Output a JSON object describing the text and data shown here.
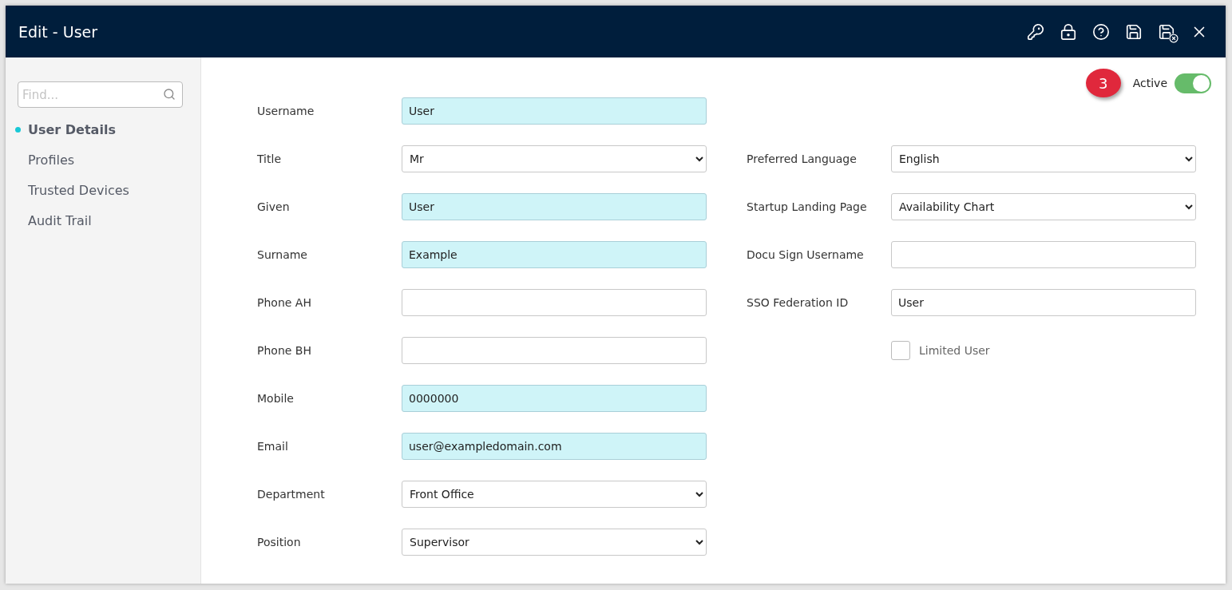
{
  "window": {
    "title": "Edit - User"
  },
  "sidebar": {
    "search": {
      "placeholder": "Find..."
    },
    "items": [
      {
        "label": "User Details",
        "selected": true
      },
      {
        "label": "Profiles",
        "selected": false
      },
      {
        "label": "Trusted Devices",
        "selected": false
      },
      {
        "label": "Audit Trail",
        "selected": false
      }
    ]
  },
  "status": {
    "label": "Active",
    "on": true,
    "callout": "3"
  },
  "left_fields": [
    {
      "label": "Username",
      "kind": "text",
      "value": "User",
      "highlighted": true
    },
    {
      "label": "Title",
      "kind": "select",
      "value": "Mr",
      "highlighted": false
    },
    {
      "label": "Given",
      "kind": "text",
      "value": "User",
      "highlighted": true
    },
    {
      "label": "Surname",
      "kind": "text",
      "value": "Example",
      "highlighted": true
    },
    {
      "label": "Phone AH",
      "kind": "text",
      "highlighted": false
    },
    {
      "label": "Phone BH",
      "kind": "text",
      "highlighted": false
    },
    {
      "label": "Mobile",
      "kind": "text",
      "value": "0000000",
      "highlighted": true
    },
    {
      "label": "Email",
      "kind": "text",
      "value": "user@exampledomain.com",
      "highlighted": true
    },
    {
      "label": "Department",
      "kind": "select",
      "value": "Front Office",
      "highlighted": false
    },
    {
      "label": "Position",
      "kind": "select",
      "value": "Supervisor",
      "highlighted": false
    }
  ],
  "right_fields": [
    {
      "label": "Preferred Language",
      "kind": "select",
      "value": "English",
      "highlighted": false
    },
    {
      "label": "Startup Landing Page",
      "kind": "select",
      "value": "Availability Chart",
      "highlighted": false
    },
    {
      "label": "Docu Sign Username",
      "kind": "text",
      "highlighted": false
    },
    {
      "label": "SSO Federation ID",
      "kind": "text",
      "value": "User",
      "highlighted": false
    },
    {
      "label": "Limited User",
      "kind": "checkbox",
      "checked": false
    }
  ]
}
